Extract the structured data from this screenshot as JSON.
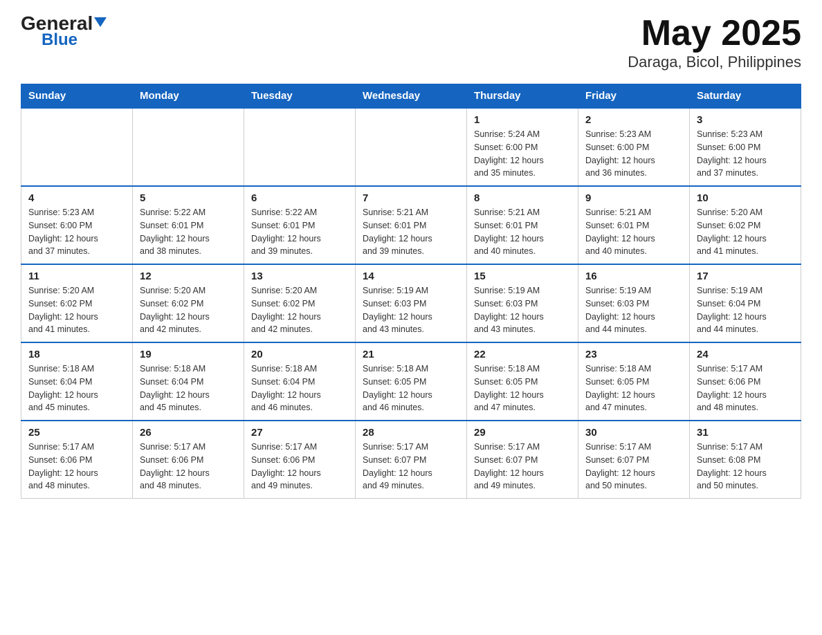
{
  "header": {
    "logo_general": "General",
    "logo_blue": "Blue",
    "title": "May 2025",
    "location": "Daraga, Bicol, Philippines"
  },
  "weekdays": [
    "Sunday",
    "Monday",
    "Tuesday",
    "Wednesday",
    "Thursday",
    "Friday",
    "Saturday"
  ],
  "weeks": [
    [
      {
        "day": "",
        "info": ""
      },
      {
        "day": "",
        "info": ""
      },
      {
        "day": "",
        "info": ""
      },
      {
        "day": "",
        "info": ""
      },
      {
        "day": "1",
        "info": "Sunrise: 5:24 AM\nSunset: 6:00 PM\nDaylight: 12 hours\nand 35 minutes."
      },
      {
        "day": "2",
        "info": "Sunrise: 5:23 AM\nSunset: 6:00 PM\nDaylight: 12 hours\nand 36 minutes."
      },
      {
        "day": "3",
        "info": "Sunrise: 5:23 AM\nSunset: 6:00 PM\nDaylight: 12 hours\nand 37 minutes."
      }
    ],
    [
      {
        "day": "4",
        "info": "Sunrise: 5:23 AM\nSunset: 6:00 PM\nDaylight: 12 hours\nand 37 minutes."
      },
      {
        "day": "5",
        "info": "Sunrise: 5:22 AM\nSunset: 6:01 PM\nDaylight: 12 hours\nand 38 minutes."
      },
      {
        "day": "6",
        "info": "Sunrise: 5:22 AM\nSunset: 6:01 PM\nDaylight: 12 hours\nand 39 minutes."
      },
      {
        "day": "7",
        "info": "Sunrise: 5:21 AM\nSunset: 6:01 PM\nDaylight: 12 hours\nand 39 minutes."
      },
      {
        "day": "8",
        "info": "Sunrise: 5:21 AM\nSunset: 6:01 PM\nDaylight: 12 hours\nand 40 minutes."
      },
      {
        "day": "9",
        "info": "Sunrise: 5:21 AM\nSunset: 6:01 PM\nDaylight: 12 hours\nand 40 minutes."
      },
      {
        "day": "10",
        "info": "Sunrise: 5:20 AM\nSunset: 6:02 PM\nDaylight: 12 hours\nand 41 minutes."
      }
    ],
    [
      {
        "day": "11",
        "info": "Sunrise: 5:20 AM\nSunset: 6:02 PM\nDaylight: 12 hours\nand 41 minutes."
      },
      {
        "day": "12",
        "info": "Sunrise: 5:20 AM\nSunset: 6:02 PM\nDaylight: 12 hours\nand 42 minutes."
      },
      {
        "day": "13",
        "info": "Sunrise: 5:20 AM\nSunset: 6:02 PM\nDaylight: 12 hours\nand 42 minutes."
      },
      {
        "day": "14",
        "info": "Sunrise: 5:19 AM\nSunset: 6:03 PM\nDaylight: 12 hours\nand 43 minutes."
      },
      {
        "day": "15",
        "info": "Sunrise: 5:19 AM\nSunset: 6:03 PM\nDaylight: 12 hours\nand 43 minutes."
      },
      {
        "day": "16",
        "info": "Sunrise: 5:19 AM\nSunset: 6:03 PM\nDaylight: 12 hours\nand 44 minutes."
      },
      {
        "day": "17",
        "info": "Sunrise: 5:19 AM\nSunset: 6:04 PM\nDaylight: 12 hours\nand 44 minutes."
      }
    ],
    [
      {
        "day": "18",
        "info": "Sunrise: 5:18 AM\nSunset: 6:04 PM\nDaylight: 12 hours\nand 45 minutes."
      },
      {
        "day": "19",
        "info": "Sunrise: 5:18 AM\nSunset: 6:04 PM\nDaylight: 12 hours\nand 45 minutes."
      },
      {
        "day": "20",
        "info": "Sunrise: 5:18 AM\nSunset: 6:04 PM\nDaylight: 12 hours\nand 46 minutes."
      },
      {
        "day": "21",
        "info": "Sunrise: 5:18 AM\nSunset: 6:05 PM\nDaylight: 12 hours\nand 46 minutes."
      },
      {
        "day": "22",
        "info": "Sunrise: 5:18 AM\nSunset: 6:05 PM\nDaylight: 12 hours\nand 47 minutes."
      },
      {
        "day": "23",
        "info": "Sunrise: 5:18 AM\nSunset: 6:05 PM\nDaylight: 12 hours\nand 47 minutes."
      },
      {
        "day": "24",
        "info": "Sunrise: 5:17 AM\nSunset: 6:06 PM\nDaylight: 12 hours\nand 48 minutes."
      }
    ],
    [
      {
        "day": "25",
        "info": "Sunrise: 5:17 AM\nSunset: 6:06 PM\nDaylight: 12 hours\nand 48 minutes."
      },
      {
        "day": "26",
        "info": "Sunrise: 5:17 AM\nSunset: 6:06 PM\nDaylight: 12 hours\nand 48 minutes."
      },
      {
        "day": "27",
        "info": "Sunrise: 5:17 AM\nSunset: 6:06 PM\nDaylight: 12 hours\nand 49 minutes."
      },
      {
        "day": "28",
        "info": "Sunrise: 5:17 AM\nSunset: 6:07 PM\nDaylight: 12 hours\nand 49 minutes."
      },
      {
        "day": "29",
        "info": "Sunrise: 5:17 AM\nSunset: 6:07 PM\nDaylight: 12 hours\nand 49 minutes."
      },
      {
        "day": "30",
        "info": "Sunrise: 5:17 AM\nSunset: 6:07 PM\nDaylight: 12 hours\nand 50 minutes."
      },
      {
        "day": "31",
        "info": "Sunrise: 5:17 AM\nSunset: 6:08 PM\nDaylight: 12 hours\nand 50 minutes."
      }
    ]
  ]
}
